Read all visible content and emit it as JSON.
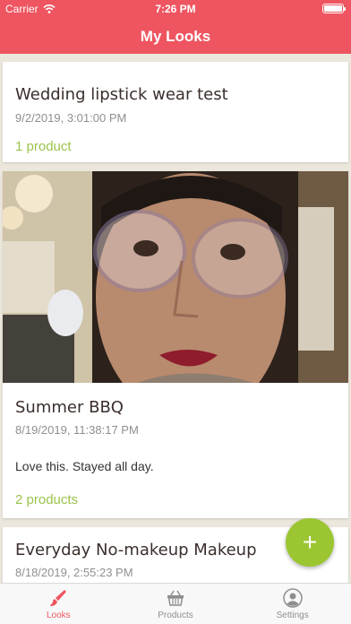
{
  "status": {
    "carrier": "Carrier",
    "time": "7:26 PM"
  },
  "nav": {
    "title": "My Looks"
  },
  "looks": [
    {
      "title": "Wedding lipstick wear test",
      "date": "9/2/2019, 3:01:00 PM",
      "products": "1 product"
    },
    {
      "title": "Summer BBQ",
      "date": "8/19/2019, 11:38:17 PM",
      "note": "Love this.  Stayed all day.",
      "products": "2 products"
    },
    {
      "title": "Everyday No-makeup Makeup",
      "date": "8/18/2019, 2:55:23 PM"
    }
  ],
  "fab": {
    "label": "+"
  },
  "tabs": [
    {
      "label": "Looks",
      "icon": "brush-icon",
      "active": true
    },
    {
      "label": "Products",
      "icon": "basket-icon",
      "active": false
    },
    {
      "label": "Settings",
      "icon": "person-icon",
      "active": false
    }
  ],
  "colors": {
    "header": "#ee5560",
    "accent": "#9bc44a",
    "fab": "#9bc631",
    "background": "#ebe7dc"
  }
}
